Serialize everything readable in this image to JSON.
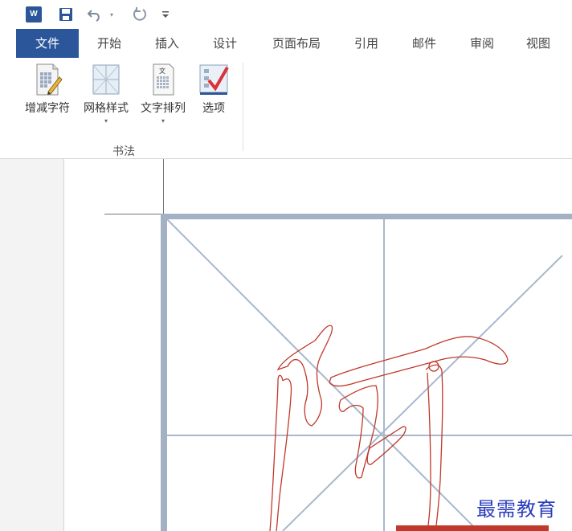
{
  "quick_access": {
    "app_logo_text": "W",
    "icons": [
      "word-logo-icon",
      "save-icon",
      "undo-icon",
      "undo-dropdown-icon",
      "redo-icon",
      "customize-dropdown-icon"
    ]
  },
  "tabs": [
    {
      "label": "文件",
      "active": true
    },
    {
      "label": "开始"
    },
    {
      "label": "插入"
    },
    {
      "label": "设计"
    },
    {
      "label": "页面布局"
    },
    {
      "label": "引用"
    },
    {
      "label": "邮件"
    },
    {
      "label": "审阅"
    },
    {
      "label": "视图"
    }
  ],
  "ribbon": {
    "buttons": [
      {
        "label": "增减字符",
        "icon": "add-remove-characters-icon"
      },
      {
        "label": "网格样式",
        "icon": "grid-style-icon",
        "dropdown": "▾"
      },
      {
        "label": "文字排列",
        "icon": "text-arrangement-icon",
        "dropdown": "▾"
      },
      {
        "label": "选项",
        "icon": "options-icon"
      }
    ],
    "group_label": "书法"
  },
  "document": {
    "grid_type": "米字格",
    "grid_color": "#a9b8cc",
    "character_outline_color": "#c0392b"
  },
  "watermark": "最需教育"
}
